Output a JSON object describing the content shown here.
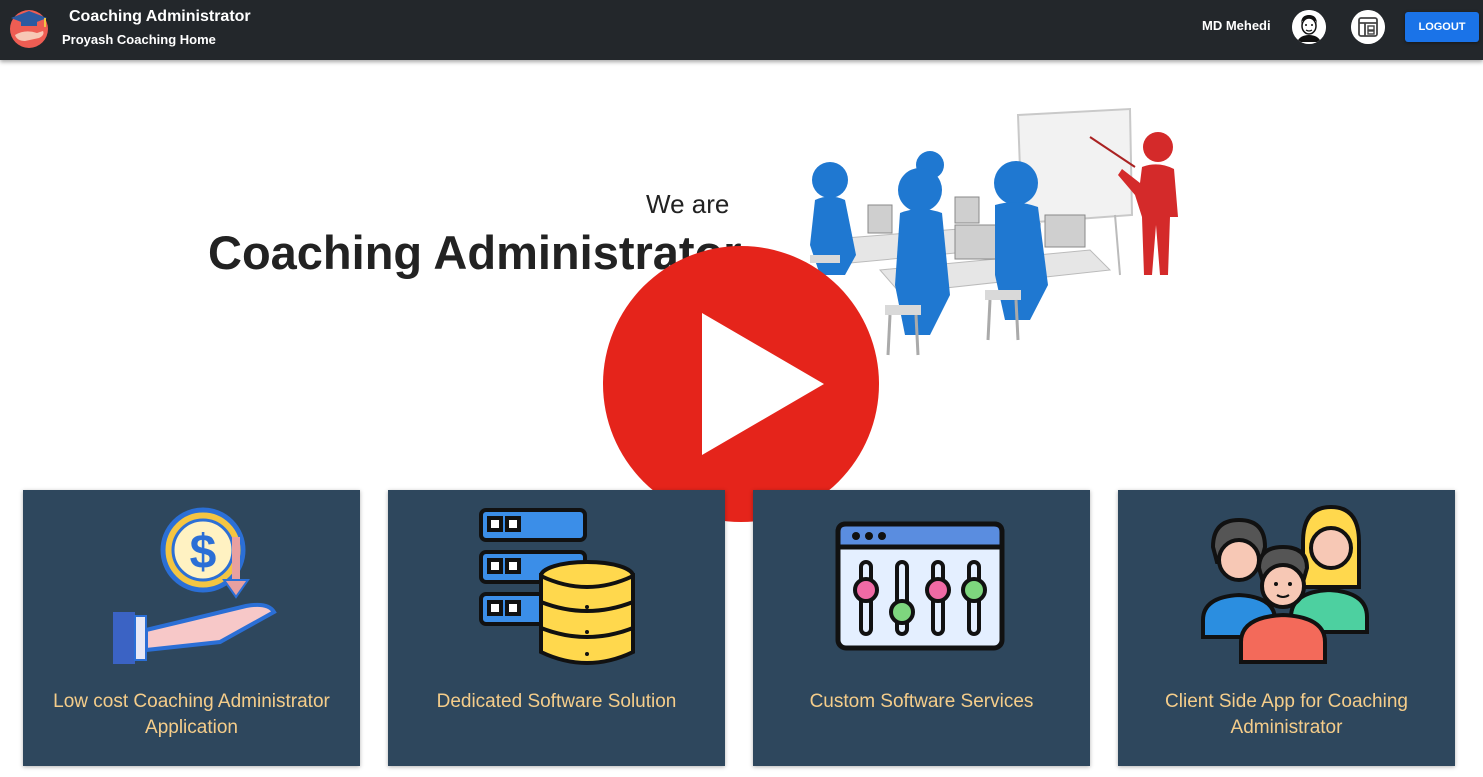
{
  "header": {
    "title": "Coaching Administrator",
    "subtitle": "Proyash Coaching Home",
    "user_name": "MD Mehedi",
    "logout_label": "LOGOUT",
    "logo_icon": "graduation-cap-hand-icon",
    "avatar_icon": "user-avatar-icon",
    "layout_icon": "dashboard-layout-icon"
  },
  "hero": {
    "pre_title": "We are",
    "title": "Coaching Administrator",
    "image": "classroom-presentation-illustration",
    "video_control": "play-icon"
  },
  "cards": [
    {
      "label": "Low cost Coaching Administrator Application",
      "icon": "dollar-coin-hand-icon"
    },
    {
      "label": "Dedicated Software Solution",
      "icon": "server-database-icon"
    },
    {
      "label": "Custom Software Services",
      "icon": "settings-sliders-icon"
    },
    {
      "label": "Client Side App for Coaching Administrator",
      "icon": "users-group-icon"
    }
  ],
  "colors": {
    "appbar_bg": "#23272b",
    "logout_bg": "#1a73e8",
    "card_bg": "#2e475d",
    "card_text": "#f5cd8a",
    "play_red": "#e5241b"
  }
}
